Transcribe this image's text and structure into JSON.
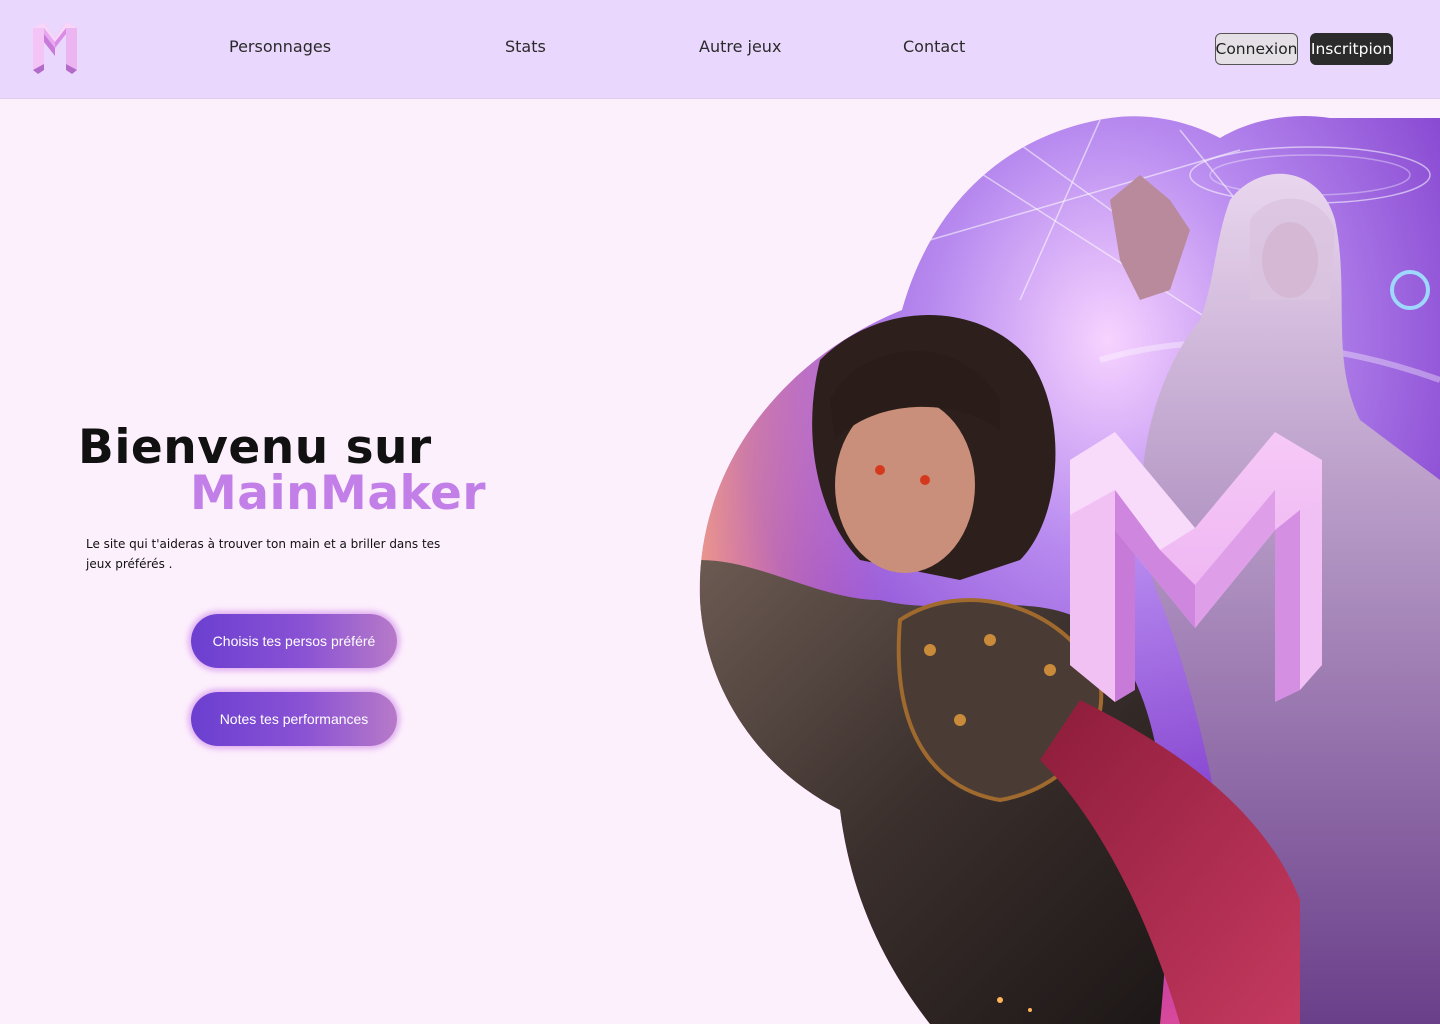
{
  "header": {
    "nav": [
      {
        "label": "Personnages"
      },
      {
        "label": "Stats"
      },
      {
        "label": "Autre jeux"
      },
      {
        "label": "Contact"
      }
    ],
    "login_label": "Connexion",
    "signup_label": "Inscritpion"
  },
  "hero": {
    "title_line1": "Bienvenu sur",
    "title_line2": "MainMaker",
    "subtitle": "Le site qui t'aideras à trouver ton main et a briller dans tes jeux préférés .",
    "cta_primary": "Choisis tes persos préféré",
    "cta_secondary": "Notes tes performances"
  },
  "art": {
    "logo_icon": "m-logo-icon",
    "image": "fantasy-warrior-and-sorceress-illustration"
  },
  "colors": {
    "header_bg": "#ead7fd",
    "page_bg": "#fdf0fd",
    "accent": "#c27fe8",
    "button_gradient_start": "#6b3fd0",
    "button_gradient_end": "#b77ac8"
  }
}
